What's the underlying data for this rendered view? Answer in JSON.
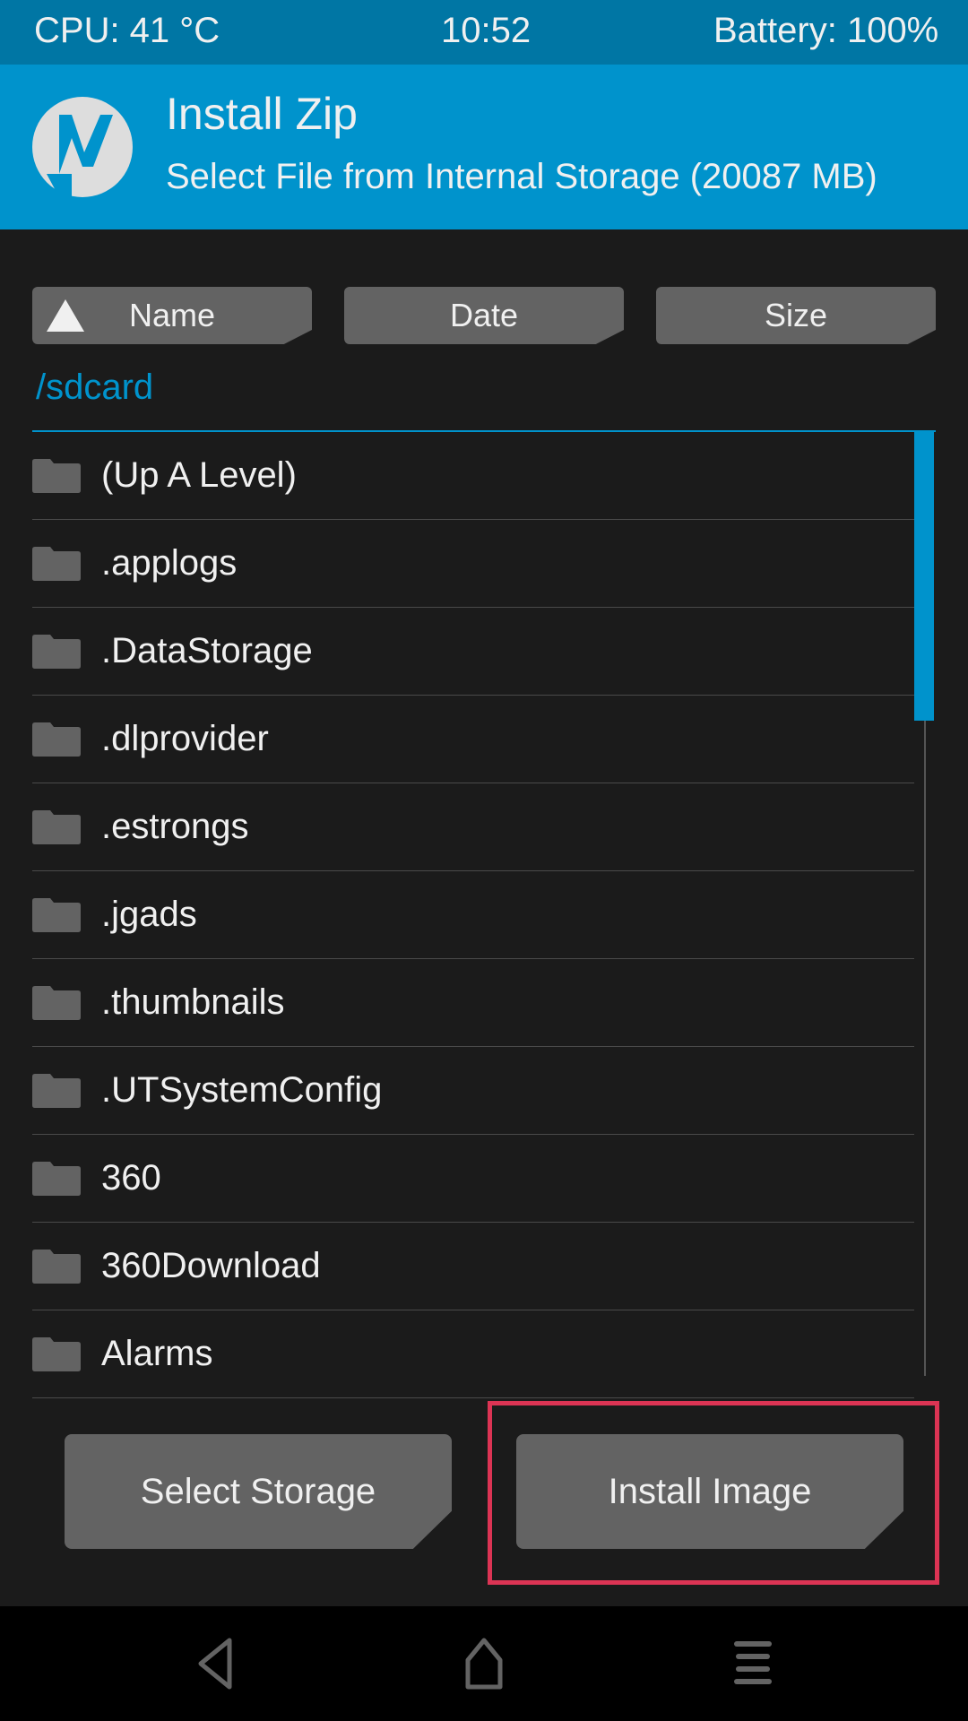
{
  "status_bar": {
    "cpu": "CPU: 41 °C",
    "time": "10:52",
    "battery": "Battery: 100%"
  },
  "header": {
    "title": "Install Zip",
    "subtitle": "Select File from Internal Storage (20087 MB)",
    "logo": "twrp-logo"
  },
  "sort": {
    "name": "Name",
    "date": "Date",
    "size": "Size",
    "active": "Name",
    "direction": "ascending"
  },
  "path": "/sdcard",
  "files": [
    "(Up A Level)",
    ".applogs",
    ".DataStorage",
    ".dlprovider",
    ".estrongs",
    ".jgads",
    ".thumbnails",
    ".UTSystemConfig",
    "360",
    "360Download",
    "Alarms"
  ],
  "buttons": {
    "select_storage": "Select Storage",
    "install_image": "Install Image"
  },
  "colors": {
    "accent": "#0093cc",
    "status_bar": "#0076a4",
    "highlight": "#dc3454",
    "button": "#636363"
  },
  "nav": {
    "back": "back-icon",
    "home": "home-icon",
    "menu": "menu-icon"
  }
}
